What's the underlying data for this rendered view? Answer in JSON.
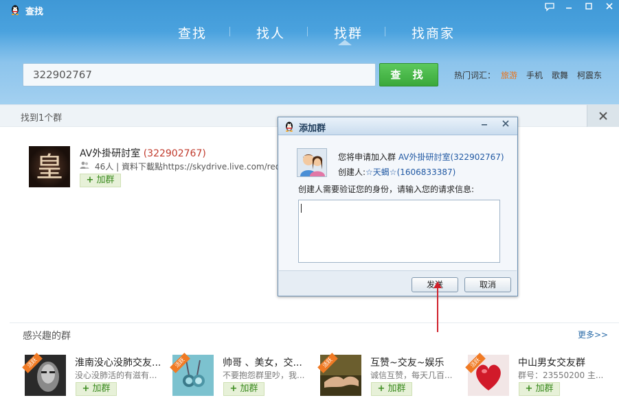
{
  "window": {
    "title": "查找"
  },
  "nav": {
    "tabs": [
      {
        "label": "查找"
      },
      {
        "label": "找人"
      },
      {
        "label": "找群",
        "active": true
      },
      {
        "label": "找商家"
      }
    ]
  },
  "search": {
    "value": "322902767",
    "button_label": "查 找",
    "hot_label": "热门词汇：",
    "hot_words": [
      "旅游",
      "手机",
      "歌舞",
      "柯震东"
    ]
  },
  "results": {
    "count_text": "找到1个群",
    "close_icon": "close-icon",
    "group": {
      "name": "AV外掛研討室 ",
      "number": "(322902767)",
      "members": "46人",
      "description": "| 資料下載點https://skydrive.live.com/redir...",
      "join_label": "加群"
    }
  },
  "interest": {
    "title": "感兴趣的群",
    "more": "更多>>",
    "badge": "活跃",
    "cards": [
      {
        "name": "淮南没心没肺交友...",
        "desc": "没心没肺活的有滋有...",
        "join_label": "加群"
      },
      {
        "name": "帅哥 、美女，交...",
        "desc": "不要抱怨群里吵，我...",
        "join_label": "加群"
      },
      {
        "name": "互赞~交友~娱乐",
        "desc": "诚信互赞，每天几百...",
        "join_label": "加群"
      },
      {
        "name": "中山男女交友群",
        "desc": "群号：23550200 主...",
        "join_label": "加群"
      }
    ]
  },
  "dialog": {
    "title": "添加群",
    "line1_prefix": "您将申请加入群 ",
    "line1_group": "AV外掛研討室",
    "line1_number": "(322902767)",
    "line2_prefix": "创建人:",
    "line2_creator": "☆天蝎☆",
    "line2_number": "(1606833387)",
    "prompt": "创建人需要验证您的身份，请输入您的请求信息:",
    "textarea_value": "",
    "send_label": "发送",
    "cancel_label": "取消"
  },
  "colors": {
    "header_blue": "#4aa2de",
    "search_green": "#3aa83a",
    "accent_orange": "#e8731d",
    "number_red": "#c0392b",
    "annotation_red": "#d0202a"
  }
}
